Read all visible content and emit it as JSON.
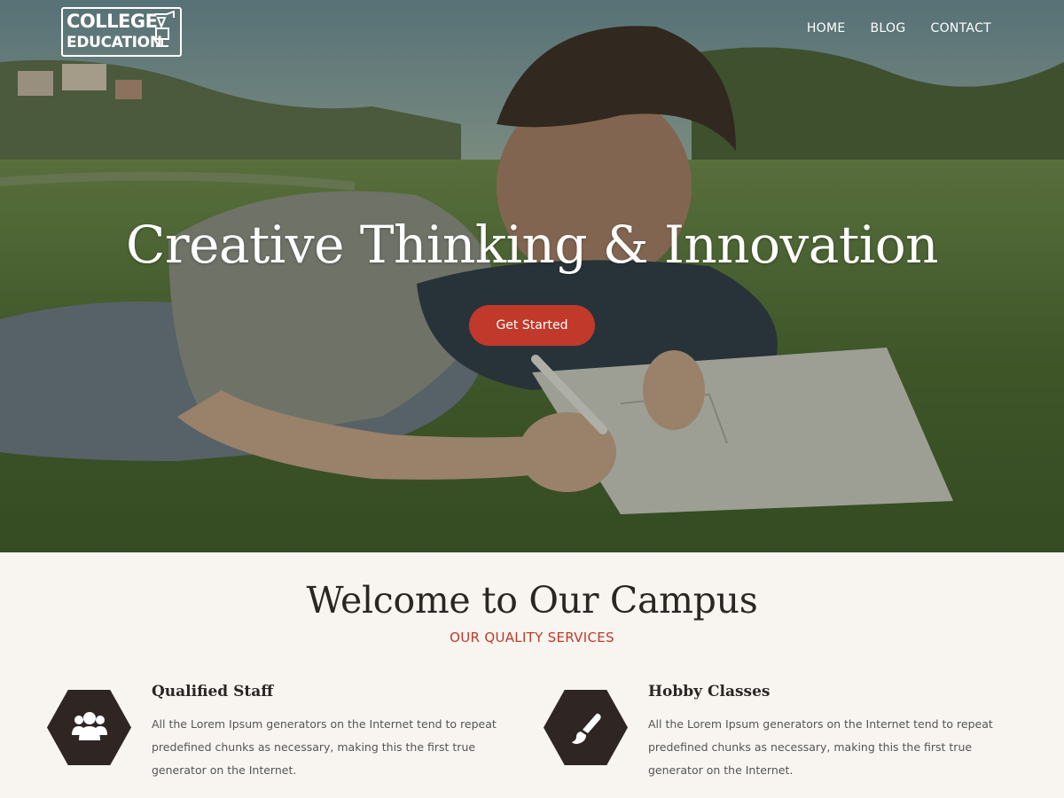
{
  "logo": {
    "line1": "COLLEGE",
    "line2": "EDUCATION"
  },
  "nav": {
    "items": [
      {
        "label": "HOME"
      },
      {
        "label": "BLOG"
      },
      {
        "label": "CONTACT"
      }
    ]
  },
  "hero": {
    "title": "Creative Thinking & Innovation",
    "cta_label": "Get Started",
    "cta_color": "#c0392b"
  },
  "welcome": {
    "title": "Welcome to Our Campus",
    "subtitle": "OUR QUALITY SERVICES",
    "features": [
      {
        "icon": "users-icon",
        "title": "Qualified Staff",
        "text": "All the Lorem Ipsum generators on the Internet tend to repeat predefined chunks as necessary, making this the first true generator on the Internet."
      },
      {
        "icon": "paintbrush-icon",
        "title": "Hobby Classes",
        "text": "All the Lorem Ipsum generators on the Internet tend to repeat predefined chunks as necessary, making this the first true generator on the Internet."
      }
    ]
  },
  "colors": {
    "accent": "#c0392b",
    "dark": "#2f2624",
    "background": "#f8f5f1"
  }
}
